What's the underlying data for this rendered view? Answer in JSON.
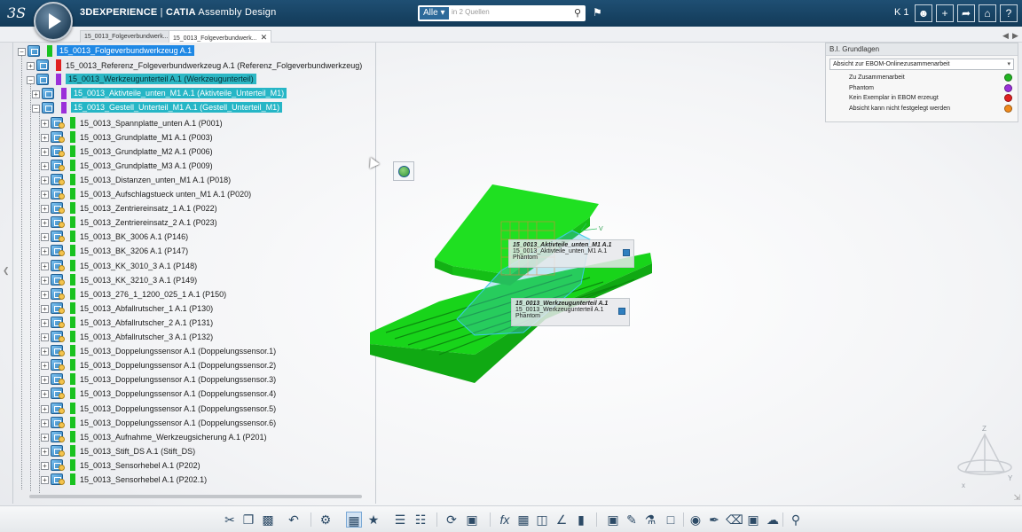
{
  "app": {
    "brand": "3DEXPERIENCE",
    "separator": " | ",
    "product": "CATIA",
    "app_name": "Assembly Design"
  },
  "search": {
    "filter": "Alle",
    "placeholder": "in 2 Quellen"
  },
  "user": {
    "label": "K 1"
  },
  "tabs": [
    {
      "label": "15_0013_Folgeverbundwerk...",
      "active": false
    },
    {
      "label": "15_0013_Folgeverbundwerk...",
      "active": true
    }
  ],
  "tree": {
    "root": "15_0013_Folgeverbundwerkzeug A.1",
    "level1": [
      "15_0013_Referenz_Folgeverbundwerkzeug A.1 (Referenz_Folgeverbundwerkzeug)",
      "15_0013_Werkzeugunterteil A.1 (Werkzeugunterteil)"
    ],
    "level2": [
      "15_0013_Aktivteile_unten_M1 A.1 (Aktivteile_Unterteil_M1)",
      "15_0013_Gestell_Unterteil_M1 A.1 (Gestell_Unterteil_M1)"
    ],
    "level3": [
      "15_0013_Spannplatte_unten A.1 (P001)",
      "15_0013_Grundplatte_M1 A.1 (P003)",
      "15_0013_Grundplatte_M2 A.1 (P006)",
      "15_0013_Grundplatte_M3 A.1 (P009)",
      "15_0013_Distanzen_unten_M1 A.1 (P018)",
      "15_0013_Aufschlagstueck unten_M1 A.1 (P020)",
      "15_0013_Zentriereinsatz_1 A.1 (P022)",
      "15_0013_Zentriereinsatz_2 A.1 (P023)",
      "15_0013_BK_3006 A.1 (P146)",
      "15_0013_BK_3206 A.1 (P147)",
      "15_0013_KK_3010_3 A.1 (P148)",
      "15_0013_KK_3210_3 A.1 (P149)",
      "15_0013_276_1_1200_025_1 A.1 (P150)",
      "15_0013_Abfallrutscher_1 A.1 (P130)",
      "15_0013_Abfallrutscher_2 A.1 (P131)",
      "15_0013_Abfallrutscher_3 A.1 (P132)",
      "15_0013_Doppelungssensor A.1 (Doppelungssensor.1)",
      "15_0013_Doppelungssensor A.1 (Doppelungssensor.2)",
      "15_0013_Doppelungssensor A.1 (Doppelungssensor.3)",
      "15_0013_Doppelungssensor A.1 (Doppelungssensor.4)",
      "15_0013_Doppelungssensor A.1 (Doppelungssensor.5)",
      "15_0013_Doppelungssensor A.1 (Doppelungssensor.6)",
      "15_0013_Aufnahme_Werkzeugsicherung A.1 (P201)",
      "15_0013_Stift_DS A.1 (Stift_DS)",
      "15_0013_Sensorhebel A.1 (P202)",
      "15_0013_Sensorhebel A.1 (P202.1)"
    ]
  },
  "tags3d": [
    {
      "title": "15_0013_Aktivteile_unten_M1 A.1",
      "line": "15_0013_Aktivteile_unten_M1 A.1",
      "status": "Phantom"
    },
    {
      "title": "15_0013_Werkzeugunterteil A.1",
      "line": "15_0013_Werkzeugunterteil A.1",
      "status": "Phantom"
    }
  ],
  "legend": {
    "title": "B.I. Grundlagen",
    "select": "Absicht zur EBOM-Onlinezusammenarbeit",
    "items": [
      {
        "label": "Zu Zusammenarbeit",
        "color": "#22b422"
      },
      {
        "label": "Phantom",
        "color": "#9b30d9"
      },
      {
        "label": "Kein Exemplar in EBOM erzeugt",
        "color": "#e02020"
      },
      {
        "label": "Absicht kann nicht festgelegt werden",
        "color": "#f08a1c"
      }
    ]
  },
  "triad": {
    "z": "Z",
    "x": "x",
    "y": "Y"
  },
  "colors": {
    "topbar": "#1a4566",
    "status_green": "#19c21f",
    "status_purple": "#9b30d9",
    "status_red": "#e02020",
    "model_green": "#18d41a",
    "highlight_blue": "#1e88e5",
    "highlight_cyan": "#26b6c6"
  }
}
